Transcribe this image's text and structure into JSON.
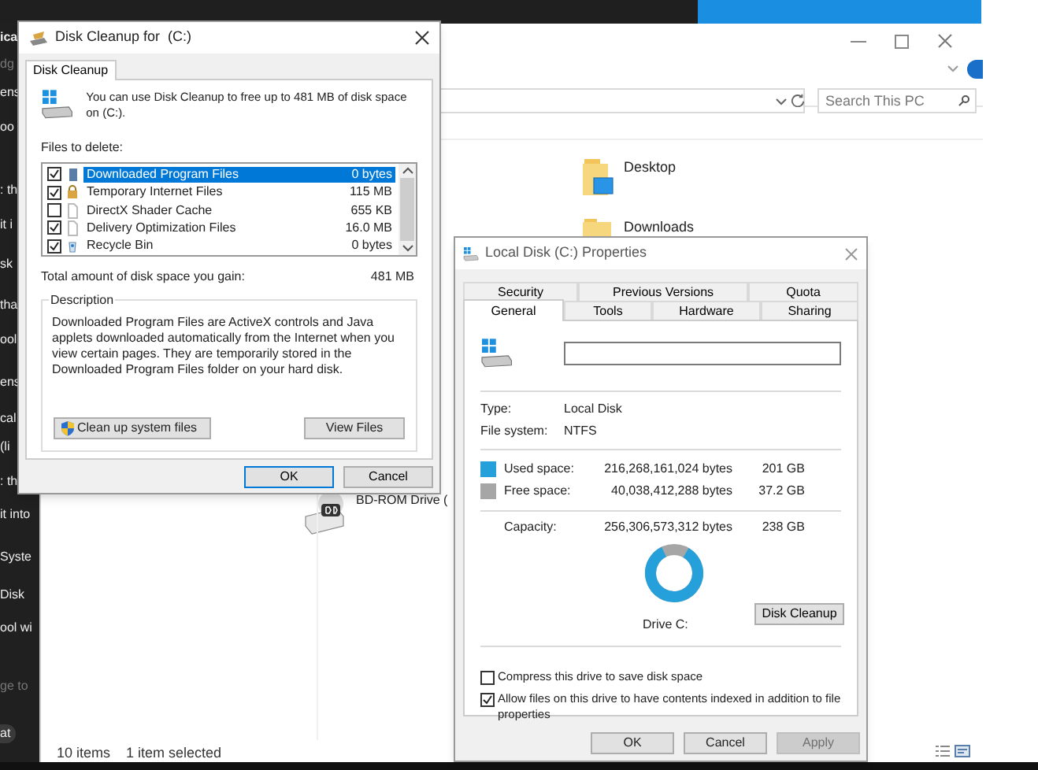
{
  "background_text": [
    "ica",
    "dg",
    "ens",
    "oo",
    ": th",
    "it i",
    "sk",
    "tha",
    "ool",
    "ens",
    "cal",
    "(li",
    ": th",
    "it into",
    "Syste",
    "Disk",
    "ool wi",
    "ge to",
    "at"
  ],
  "explorer": {
    "search": {
      "placeholder": "Search This PC"
    },
    "items": [
      {
        "label": "Desktop",
        "kind": "desktop"
      },
      {
        "label": "Downloads",
        "kind": "folder"
      },
      {
        "label": "BD-ROM Drive (",
        "kind": "optical"
      }
    ],
    "status_bar": [
      "10 items",
      "1 item selected"
    ]
  },
  "disk_cleanup": {
    "title": "Disk Cleanup for  (C:)",
    "tabs": [
      {
        "label": "Disk Cleanup",
        "selected": true
      }
    ],
    "intro": "You can use Disk Cleanup to free up to 481 MB of disk space on (C:).",
    "files_label": "Files to delete:",
    "files": [
      {
        "name": "Downloaded Program Files",
        "size": "0 bytes",
        "checked": true,
        "selected": true,
        "kind": "folder"
      },
      {
        "name": "Temporary Internet Files",
        "size": "115 MB",
        "checked": true,
        "selected": false,
        "kind": "lock"
      },
      {
        "name": "DirectX Shader Cache",
        "size": "655 KB",
        "checked": false,
        "selected": false,
        "kind": "page"
      },
      {
        "name": "Delivery Optimization Files",
        "size": "16.0 MB",
        "checked": true,
        "selected": false,
        "kind": "page"
      },
      {
        "name": "Recycle Bin",
        "size": "0 bytes",
        "checked": true,
        "selected": false,
        "kind": "bin"
      }
    ],
    "total_label": "Total amount of disk space you gain:",
    "total": "481 MB",
    "description_title": "Description",
    "description": "Downloaded Program Files are ActiveX controls and Java applets downloaded automatically from the Internet when you view certain pages. They are temporarily stored in the Downloaded Program Files folder on your hard disk.",
    "buttons": [
      {
        "label": "Clean up system files",
        "kind": "shield"
      },
      {
        "label": "View Files",
        "kind": "plain"
      }
    ],
    "footer_buttons": [
      {
        "label": "OK",
        "default": true
      },
      {
        "label": "Cancel",
        "default": false
      }
    ]
  },
  "properties": {
    "title": "Local Disk (C:) Properties",
    "tabs_back": [
      {
        "label": "Security",
        "selected": false
      },
      {
        "label": "Previous Versions",
        "selected": false
      },
      {
        "label": "Quota",
        "selected": false
      }
    ],
    "tabs_front": [
      {
        "label": "General",
        "selected": true
      },
      {
        "label": "Tools",
        "selected": false
      },
      {
        "label": "Hardware",
        "selected": false
      },
      {
        "label": "Sharing",
        "selected": false
      }
    ],
    "info": [
      {
        "label": "Type:",
        "value": "Local Disk"
      },
      {
        "label": "File system:",
        "value": "NTFS"
      }
    ],
    "space": [
      {
        "label": "Used space:",
        "bytes": "216,268,161,024 bytes",
        "size": "201 GB",
        "color": "#26a0da"
      },
      {
        "label": "Free space:",
        "bytes": "40,038,412,288 bytes",
        "size": "37.2 GB",
        "color": "#a6a6a6"
      }
    ],
    "capacity": {
      "label": "Capacity:",
      "bytes": "256,306,573,312 bytes",
      "size": "238 GB"
    },
    "usage": {
      "level": 0.844
    },
    "drive_label": "Drive C:",
    "cleanup_button": "Disk Cleanup",
    "options": [
      {
        "label": "Compress this drive to save disk space",
        "checked": false
      },
      {
        "label": "Allow files on this drive to have contents indexed in addition to file properties",
        "checked": true
      }
    ],
    "buttons": [
      {
        "label": "OK",
        "disabled": false
      },
      {
        "label": "Cancel",
        "disabled": false
      },
      {
        "label": "Apply",
        "disabled": true
      }
    ]
  }
}
